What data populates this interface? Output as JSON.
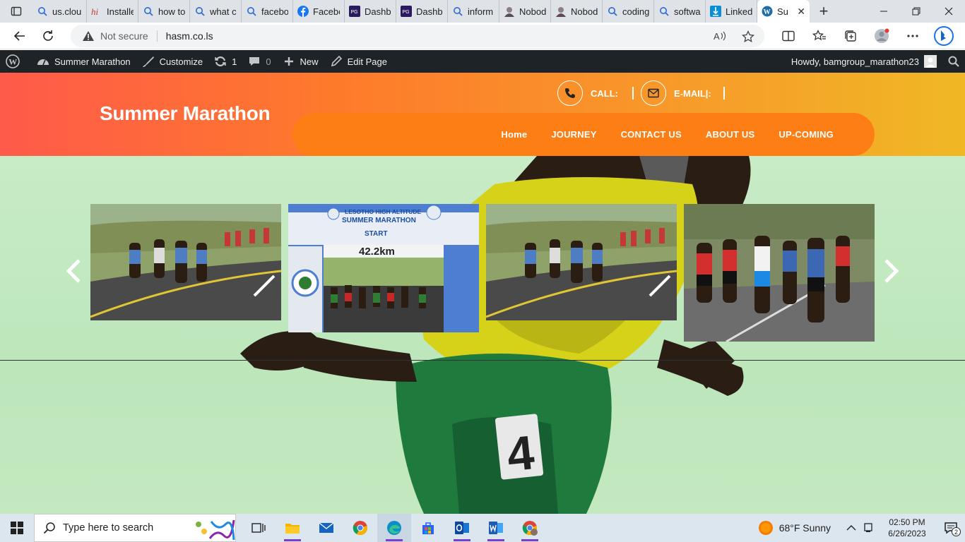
{
  "browser": {
    "tabs": [
      {
        "label": "us.clou",
        "icon": "search-icon"
      },
      {
        "label": "Installe",
        "icon": "hi-icon"
      },
      {
        "label": "how to",
        "icon": "search-icon"
      },
      {
        "label": "what c",
        "icon": "search-icon"
      },
      {
        "label": "facebo",
        "icon": "search-icon"
      },
      {
        "label": "Facebo",
        "icon": "facebook-icon"
      },
      {
        "label": "Dashb",
        "icon": "dashboard-icon"
      },
      {
        "label": "Dashb",
        "icon": "dashboard-icon"
      },
      {
        "label": "inform",
        "icon": "search-icon"
      },
      {
        "label": "Nobod",
        "icon": "nobody-icon"
      },
      {
        "label": "Nobod",
        "icon": "nobody-icon"
      },
      {
        "label": "coding",
        "icon": "search-icon"
      },
      {
        "label": "softwa",
        "icon": "search-icon"
      },
      {
        "label": "Linked",
        "icon": "linkedin-icon"
      },
      {
        "label": "Su",
        "icon": "wordpress-icon",
        "active": true
      }
    ],
    "security_label": "Not secure",
    "url": "hasm.co.ls"
  },
  "wpadmin": {
    "site_name": "Summer Marathon",
    "customize": "Customize",
    "updates_count": "1",
    "comments_count": "0",
    "new_label": "New",
    "edit_page": "Edit Page",
    "howdy": "Howdy, bamgroup_marathon23"
  },
  "site": {
    "title": "Summer Marathon",
    "call_label": "CALL:",
    "email_label": "E-MAIL|:",
    "menu": [
      "Home",
      "JOURNEY",
      "CONTACT US",
      "ABOUT US",
      "UP-COMING"
    ]
  },
  "slider": {
    "banner_line1": "LESOTHO HIGH ALTITUDE",
    "banner_line2": "SUMMER MARATHON",
    "banner_line3": "START",
    "banner_distance": "42.2km",
    "hero_bib": "4"
  },
  "taskbar": {
    "search_placeholder": "Type here to search",
    "weather": "68°F  Sunny",
    "time": "02:50 PM",
    "date": "6/26/2023",
    "notifications": "2"
  },
  "colors": {
    "header_start": "#ff5a4a",
    "header_end": "#f0b825",
    "menu_pill": "#fd7e14",
    "wp_bar": "#1d2327"
  }
}
